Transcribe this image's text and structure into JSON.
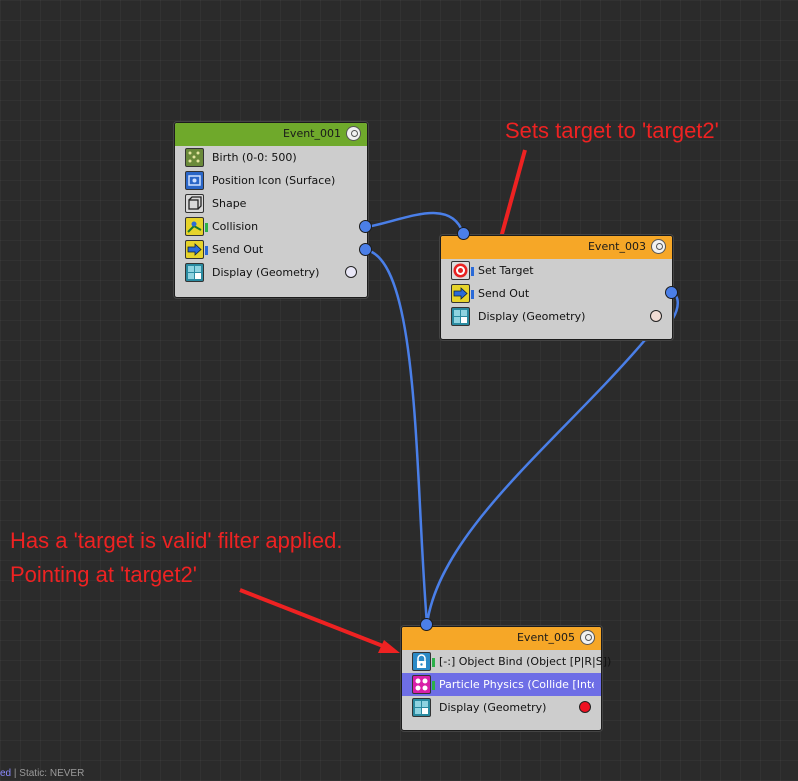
{
  "nodes": {
    "event_001": {
      "title": "Event_001",
      "header_color": "#6fa92b",
      "operators": [
        {
          "label": "Birth (0-0: 500)",
          "icon": "birth-icon"
        },
        {
          "label": "Position Icon (Surface)",
          "icon": "position-icon"
        },
        {
          "label": "Shape",
          "icon": "shape-icon"
        },
        {
          "label": "Collision",
          "icon": "collision-icon"
        },
        {
          "label": "Send Out",
          "icon": "send-out-icon"
        },
        {
          "label": "Display (Geometry)",
          "icon": "display-icon"
        }
      ]
    },
    "event_003": {
      "title": "Event_003",
      "header_color": "#f6a727",
      "operators": [
        {
          "label": "Set Target",
          "icon": "target-icon"
        },
        {
          "label": "Send Out",
          "icon": "send-out-icon"
        },
        {
          "label": "Display (Geometry)",
          "icon": "display-icon"
        }
      ]
    },
    "event_005": {
      "title": "Event_005",
      "header_color": "#f6a727",
      "operators": [
        {
          "label": "[-:] Object Bind (Object [P|R|S])",
          "icon": "object-bind-icon"
        },
        {
          "label": "Particle Physics (Collide [Integ...",
          "icon": "particle-physics-icon"
        },
        {
          "label": "Display (Geometry)",
          "icon": "display-icon"
        }
      ]
    }
  },
  "annotations": {
    "top": "Sets target to 'target2'",
    "bottom_line1": "Has a 'target is valid' filter applied.",
    "bottom_line2": "Pointing at 'target2'"
  },
  "status": {
    "left": "ed",
    "right": " | Static: NEVER"
  },
  "colors": {
    "wire": "#4a7fe8",
    "annotation": "#ee2222",
    "display_dot_001": "#e9e7f7",
    "display_dot_003": "#f0dcd4",
    "display_dot_005": "#ee1122"
  }
}
